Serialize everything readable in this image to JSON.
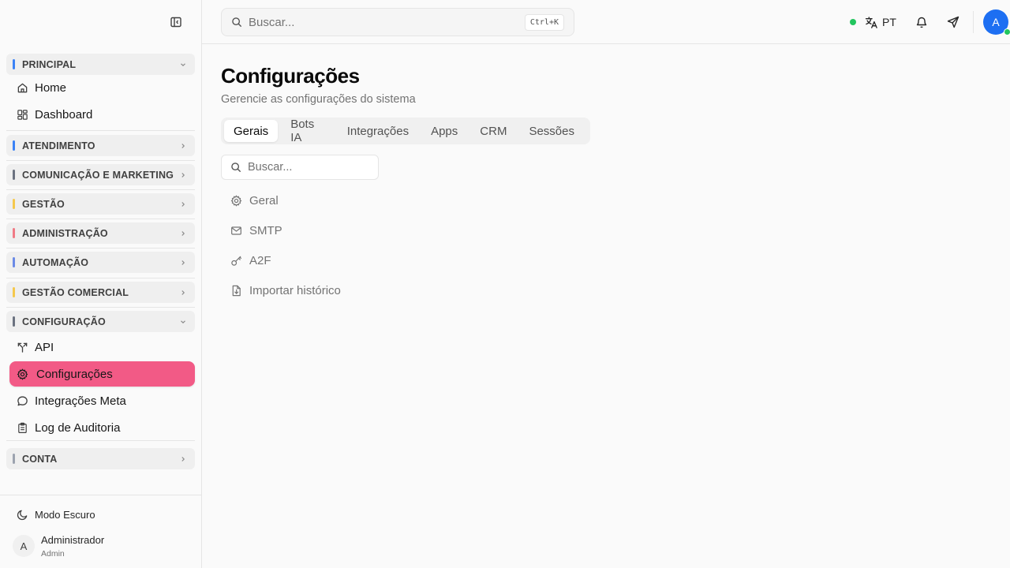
{
  "sidebar": {
    "groups": [
      {
        "label": "PRINCIPAL",
        "color": "#3b82f6",
        "expanded": true
      },
      {
        "label": "ATENDIMENTO",
        "color": "#3b82f6",
        "expanded": false
      },
      {
        "label": "COMUNICAÇÃO E MARKETING",
        "color": "#6b7280",
        "expanded": false
      },
      {
        "label": "GESTÃO",
        "color": "#f5c84c",
        "expanded": false
      },
      {
        "label": "ADMINISTRAÇÃO",
        "color": "#f07a85",
        "expanded": false
      },
      {
        "label": "AUTOMAÇÃO",
        "color": "#6b8ae6",
        "expanded": false
      },
      {
        "label": "GESTÃO COMERCIAL",
        "color": "#f5c84c",
        "expanded": false
      },
      {
        "label": "CONFIGURAÇÃO",
        "color": "#6b7280",
        "expanded": true
      },
      {
        "label": "CONTA",
        "color": "#9ca3af",
        "expanded": false
      }
    ],
    "principal_items": [
      {
        "label": "Home",
        "icon": "home-icon"
      },
      {
        "label": "Dashboard",
        "icon": "dashboard-icon"
      }
    ],
    "config_items": [
      {
        "label": "API",
        "icon": "api-icon"
      },
      {
        "label": "Configurações",
        "icon": "gear-icon",
        "active": true
      },
      {
        "label": "Integrações Meta",
        "icon": "chat-bubble-icon"
      },
      {
        "label": "Log de Auditoria",
        "icon": "clipboard-icon"
      }
    ],
    "dark_mode_label": "Modo Escuro",
    "user": {
      "initial": "A",
      "name": "Administrador",
      "role": "Admin"
    },
    "active_color": "#f25a86"
  },
  "header": {
    "search_placeholder": "Buscar...",
    "shortcut": "Ctrl+K",
    "language": "PT",
    "avatar_initial": "A",
    "avatar_color": "#1d6ff2",
    "status_color": "#22c55e"
  },
  "main": {
    "title": "Configurações",
    "subtitle": "Gerencie as configurações do sistema",
    "tabs": [
      {
        "label": "Gerais",
        "active": true
      },
      {
        "label": "Bots IA"
      },
      {
        "label": "Integrações"
      },
      {
        "label": "Apps"
      },
      {
        "label": "CRM"
      },
      {
        "label": "Sessões"
      }
    ],
    "search_placeholder": "Buscar...",
    "items": [
      {
        "label": "Geral",
        "icon": "gear-icon"
      },
      {
        "label": "SMTP",
        "icon": "mail-icon"
      },
      {
        "label": "A2F",
        "icon": "key-icon"
      },
      {
        "label": "Importar histórico",
        "icon": "file-import-icon"
      }
    ]
  }
}
